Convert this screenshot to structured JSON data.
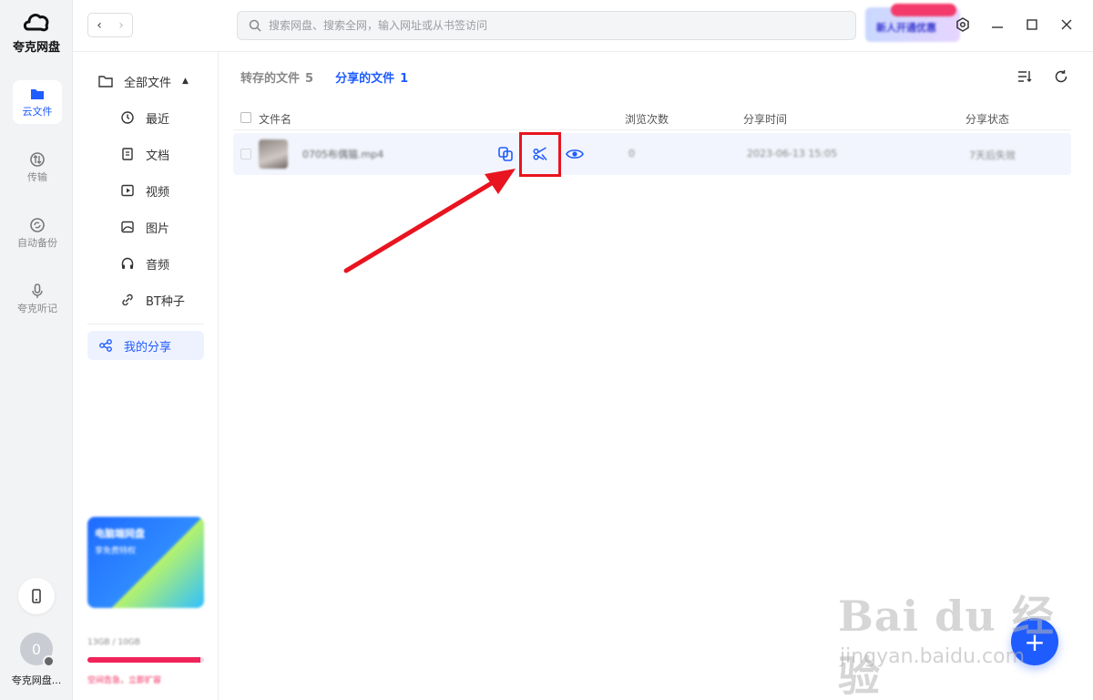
{
  "app": {
    "name": "夸克网盘"
  },
  "rail": {
    "items": [
      {
        "label": "云文件"
      },
      {
        "label": "传输"
      },
      {
        "label": "自动备份"
      },
      {
        "label": "夸克听记"
      }
    ],
    "avatar_initial": "0",
    "user_name": "夸克网盘..."
  },
  "topbar": {
    "search_placeholder": "搜索网盘、搜索全网，输入网址或从书签访问",
    "promo_label": "新人开通优惠"
  },
  "sidebar": {
    "items": [
      {
        "label": "全部文件"
      },
      {
        "label": "最近"
      },
      {
        "label": "文档"
      },
      {
        "label": "视频"
      },
      {
        "label": "图片"
      },
      {
        "label": "音频"
      },
      {
        "label": "BT种子"
      },
      {
        "label": "我的分享"
      }
    ],
    "banner_title": "电脑端网盘",
    "banner_sub": "享免费特权",
    "storage_text": "13GB / 10GB",
    "storage_fill": 0.97,
    "storage_cta": "空间告急，立即扩容"
  },
  "main": {
    "tabs": [
      {
        "label": "转存的文件",
        "count": "5"
      },
      {
        "label": "分享的文件",
        "count": "1"
      }
    ],
    "columns": {
      "name": "文件名",
      "views": "浏览次数",
      "time": "分享时间",
      "status": "分享状态"
    },
    "rows": [
      {
        "name": "0705布偶猫.mp4",
        "views": "0",
        "time": "2023-06-13 15:05",
        "status": "7天后失效"
      }
    ]
  },
  "watermark": {
    "big": "Bai du 经验",
    "small": "jingyan.baidu.com"
  },
  "colors": {
    "accent": "#1f5cff",
    "highlight": "#e8141f"
  }
}
